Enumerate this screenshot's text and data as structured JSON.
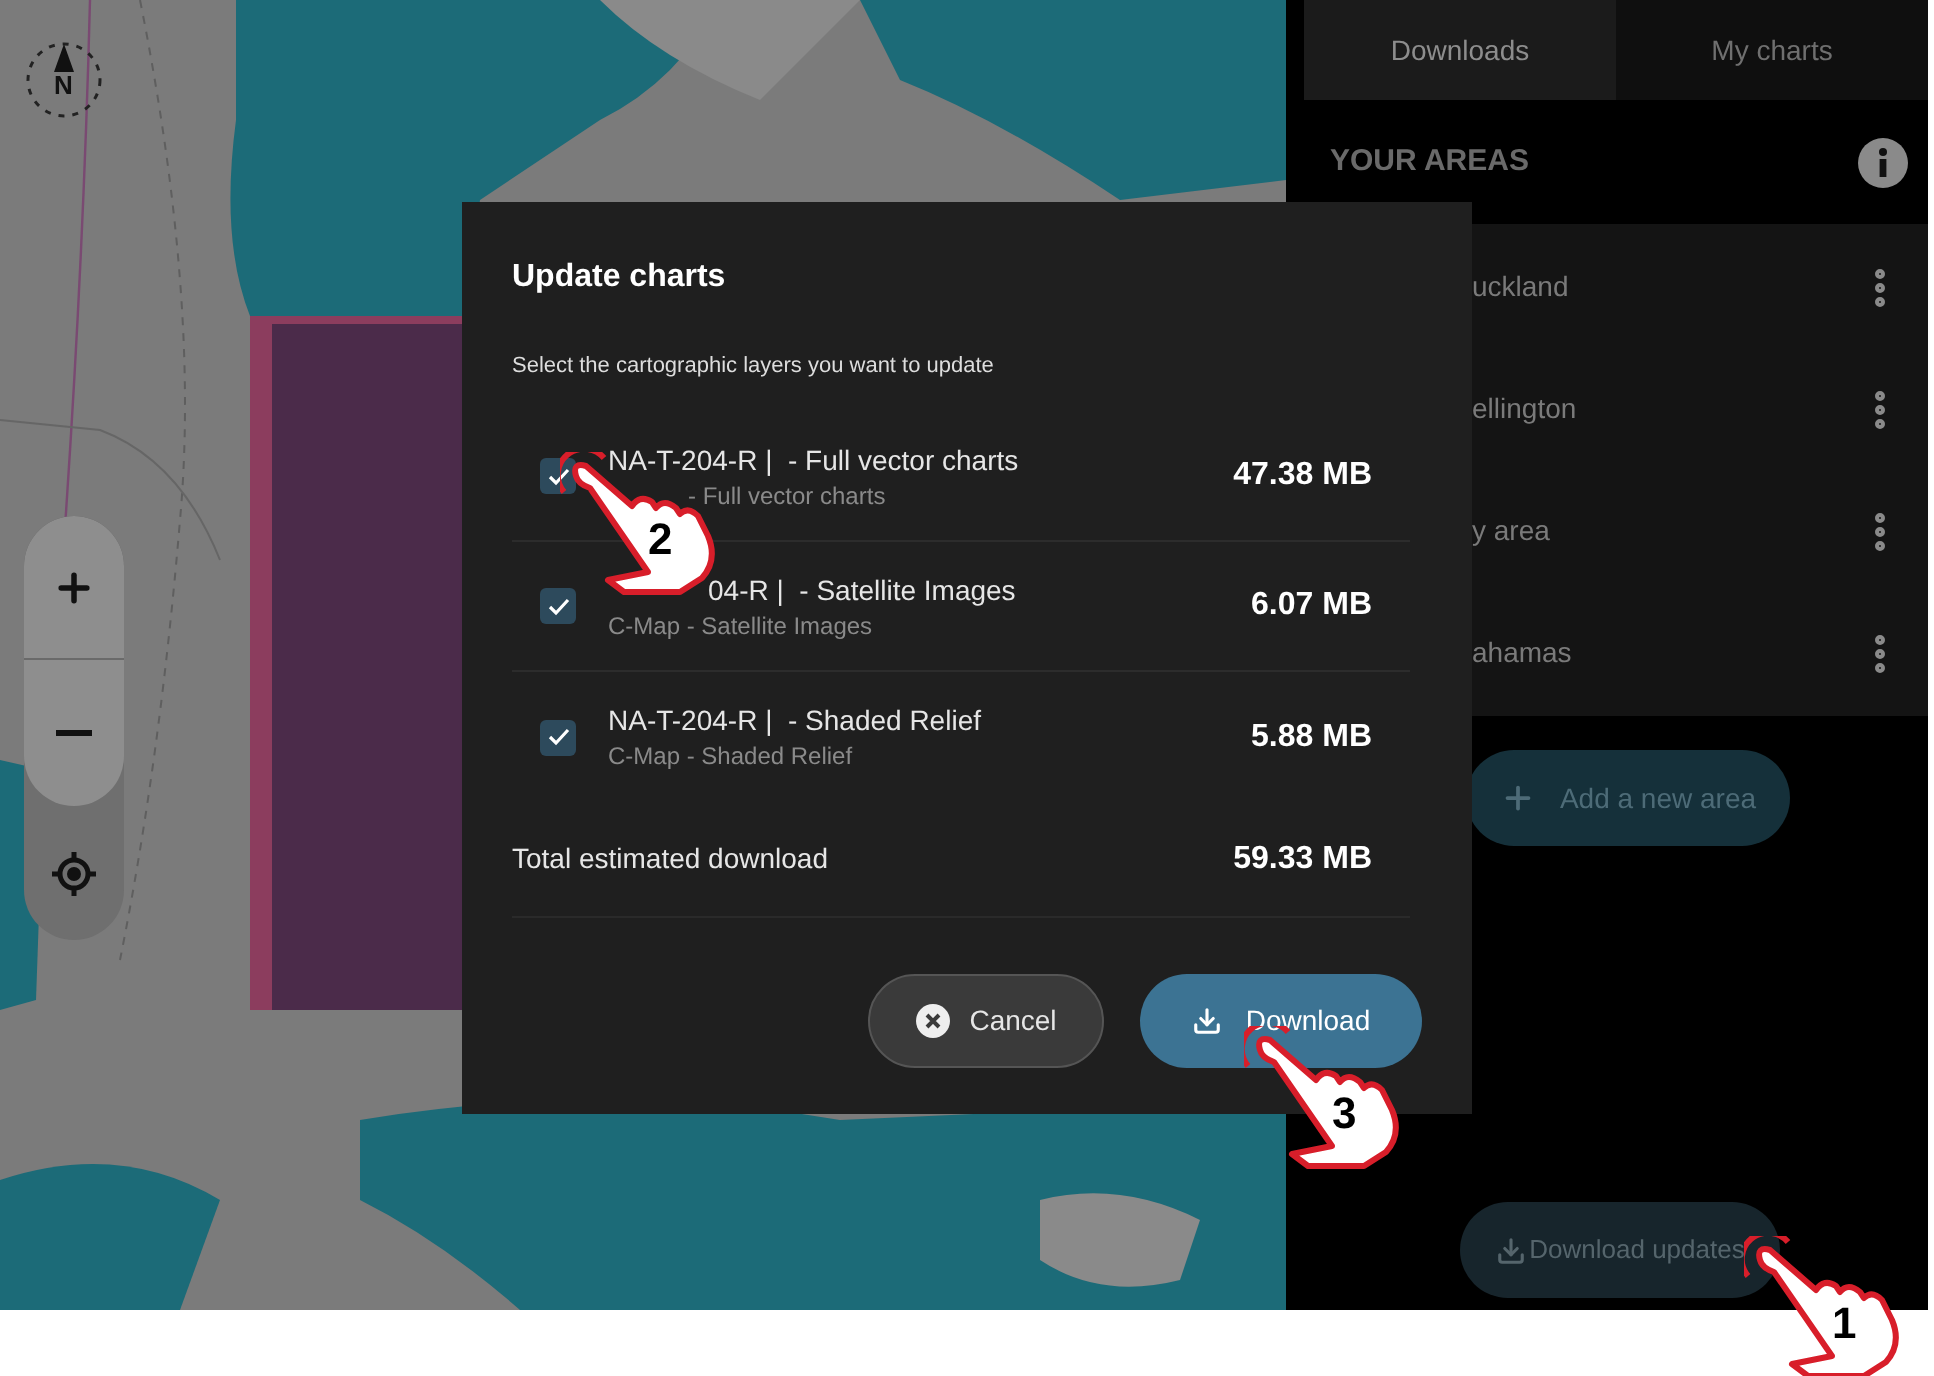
{
  "map": {
    "compass_label": "N"
  },
  "sidebar": {
    "tabs": [
      {
        "label": "Downloads",
        "selected": true
      },
      {
        "label": "My charts",
        "selected": false
      }
    ],
    "section_title": "YOUR AREAS",
    "areas": [
      {
        "name": "uckland"
      },
      {
        "name": "ellington"
      },
      {
        "name": "y area"
      },
      {
        "name": "ahamas"
      }
    ],
    "add_area_button": "Add a new area",
    "download_updates_button": "Download updates"
  },
  "dialog": {
    "title": "Update charts",
    "subtitle": "Select the cartographic layers you want to update",
    "layers": [
      {
        "name": "NA-T-204-R |  - Full vector charts",
        "source": "- Full vector charts",
        "size": "47.38 MB",
        "checked": true
      },
      {
        "name": "04-R |  - Satellite Images",
        "source": "C-Map - Satellite Images",
        "size": "6.07 MB",
        "checked": true
      },
      {
        "name": "NA-T-204-R |  - Shaded Relief",
        "source": "C-Map - Shaded Relief",
        "size": "5.88 MB",
        "checked": true
      }
    ],
    "total_label": "Total estimated download",
    "total": "59.33 MB",
    "cancel_button": "Cancel",
    "download_button": "Download"
  },
  "callouts": [
    {
      "number": "1"
    },
    {
      "number": "2"
    },
    {
      "number": "3"
    }
  ]
}
